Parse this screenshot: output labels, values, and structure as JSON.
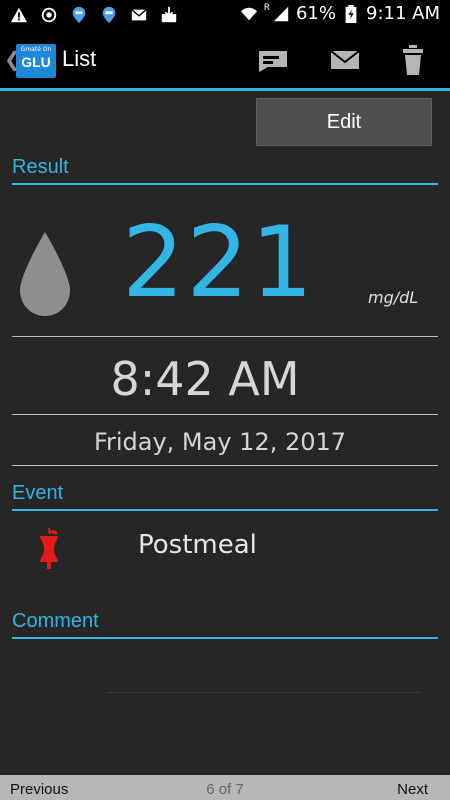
{
  "status_bar": {
    "battery_percent": "61%",
    "time": "9:11 AM",
    "left_icons": [
      "warning-icon",
      "sync-icon",
      "map-pin-icon",
      "map-pin-icon",
      "email-icon",
      "download-icon"
    ],
    "right_icons": [
      "wifi-icon",
      "signal-icon",
      "battery-icon"
    ],
    "roaming_mark": "R"
  },
  "action_bar": {
    "logo_small": "Gmaté On",
    "logo_big": "GLU",
    "title": "List",
    "buttons": [
      "comment-icon",
      "email-icon",
      "trash-icon"
    ]
  },
  "edit_label": "Edit",
  "result": {
    "title": "Result",
    "value": "221",
    "unit": "mg/dL",
    "time": "8:42 AM",
    "date": "Friday, May 12, 2017"
  },
  "event": {
    "title": "Event",
    "label": "Postmeal",
    "icon": "apple-core-icon",
    "icon_color": "#e21b1b"
  },
  "comment": {
    "title": "Comment",
    "value": ""
  },
  "pager": {
    "previous": "Previous",
    "position": "6 of 7",
    "next": "Next"
  },
  "colors": {
    "accent": "#33b5e5",
    "background": "#262626"
  }
}
